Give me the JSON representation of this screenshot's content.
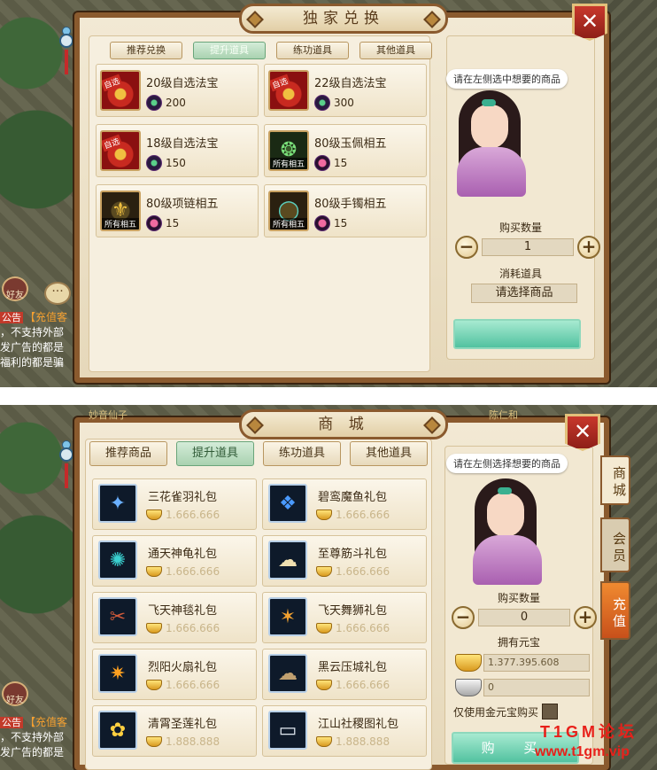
{
  "exchange": {
    "title": "独家兑换",
    "tabs": [
      "推荐兑换",
      "提升道具",
      "练功道具",
      "其他道具"
    ],
    "active_tab": 1,
    "items": [
      {
        "name": "20级自选法宝",
        "cost": "200",
        "tag": "自选",
        "icon": "treasure-icon",
        "cost_icon": "jade-token-icon"
      },
      {
        "name": "22级自选法宝",
        "cost": "300",
        "tag": "自选",
        "icon": "treasure-icon",
        "cost_icon": "jade-token-icon"
      },
      {
        "name": "18级自选法宝",
        "cost": "150",
        "tag": "自选",
        "icon": "treasure-icon",
        "cost_icon": "jade-token-icon"
      },
      {
        "name": "80级玉佩相五",
        "cost": "15",
        "tag": "所有相五",
        "icon": "jade-pendant-icon",
        "cost_icon": "pink-token-icon"
      },
      {
        "name": "80级项链相五",
        "cost": "15",
        "tag": "所有相五",
        "icon": "necklace-icon",
        "cost_icon": "pink-token-icon"
      },
      {
        "name": "80级手镯相五",
        "cost": "15",
        "tag": "所有相五",
        "icon": "bracelet-icon",
        "cost_icon": "pink-token-icon"
      }
    ],
    "speech": "请在左侧选中想要的商品",
    "qty_label": "购买数量",
    "qty_value": "1",
    "consume_label": "消耗道具",
    "select_placeholder": "请选择商品",
    "chat": {
      "friend_label": "好友",
      "notice_tag": "公告",
      "lines": [
        "【充值客",
        "，不支持外部",
        "发广告的都是",
        "福利的都是骗"
      ]
    }
  },
  "shop": {
    "title": "商 城",
    "tabs": [
      "推荐商品",
      "提升道具",
      "练功道具",
      "其他道具"
    ],
    "active_tab": 1,
    "items": [
      {
        "name": "三花雀羽礼包",
        "price": "1.666.666",
        "icon": "feather-gift-icon"
      },
      {
        "name": "碧鸾魔鱼礼包",
        "price": "1.666.666",
        "icon": "fish-gift-icon"
      },
      {
        "name": "通天神龟礼包",
        "price": "1.666.666",
        "icon": "turtle-gift-icon"
      },
      {
        "name": "至尊筋斗礼包",
        "price": "1.666.666",
        "icon": "cloud-gift-icon"
      },
      {
        "name": "飞天神毯礼包",
        "price": "1.666.666",
        "icon": "carpet-gift-icon"
      },
      {
        "name": "飞天舞狮礼包",
        "price": "1.666.666",
        "icon": "lion-gift-icon"
      },
      {
        "name": "烈阳火扇礼包",
        "price": "1.666.666",
        "icon": "fan-gift-icon"
      },
      {
        "name": "黑云压城礼包",
        "price": "1.666.666",
        "icon": "dark-cloud-gift-icon"
      },
      {
        "name": "清霄圣莲礼包",
        "price": "1.888.888",
        "icon": "lotus-gift-icon"
      },
      {
        "name": "江山社稷图礼包",
        "price": "1.888.888",
        "icon": "scroll-gift-icon"
      }
    ],
    "speech": "请在左侧选择想要的商品",
    "qty_label": "购买数量",
    "qty_value": "0",
    "owned_label": "拥有元宝",
    "gold_amount": "1.377.395.608",
    "silver_amount": "0",
    "gold_only_label": "仅使用金元宝购买",
    "buy_label": "购 买",
    "side_tabs": [
      "商城",
      "会员",
      "充值"
    ],
    "chat": {
      "friend_label": "好友",
      "notice_tag": "公告",
      "lines": [
        "【充值客",
        "，不支持外部",
        "发广告的都是"
      ]
    },
    "bg_labels": [
      "妙音仙子",
      "陈仁和"
    ]
  },
  "watermark": {
    "line1": "T1GM论坛",
    "line2": "www.t1gm.vip"
  },
  "colors": {
    "active_tab": "#a9d2b0",
    "close": "#c8382c",
    "frame": "#8a5a2e",
    "watermark": "#e8201a"
  }
}
